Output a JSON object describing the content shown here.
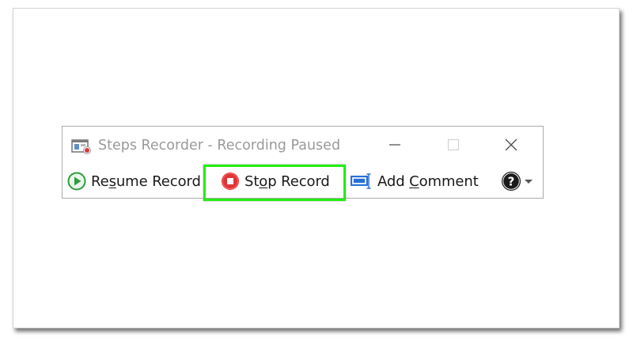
{
  "window": {
    "title": "Steps Recorder - Recording Paused",
    "icon": "steps-recorder-icon"
  },
  "titlebar_buttons": {
    "minimize_icon": "minimize-icon",
    "maximize_icon": "maximize-icon",
    "close_icon": "close-icon"
  },
  "toolbar": {
    "resume": {
      "pre": "Re",
      "accel": "s",
      "post": "ume Record",
      "icon": "play-icon"
    },
    "stop": {
      "pre": "St",
      "accel": "o",
      "post": "p Record",
      "icon": "stop-icon"
    },
    "comment": {
      "pre": "Add ",
      "accel": "C",
      "post": "omment",
      "icon": "comment-icon"
    },
    "help": {
      "icon": "help-icon",
      "dropdown_icon": "dropdown-arrow-icon"
    }
  },
  "colors": {
    "highlight": "#22ee11",
    "play_green": "#2e9c3e",
    "stop_red": "#e23434",
    "comment_blue": "#2a6fd6",
    "title_gray": "#9a9a9a"
  }
}
